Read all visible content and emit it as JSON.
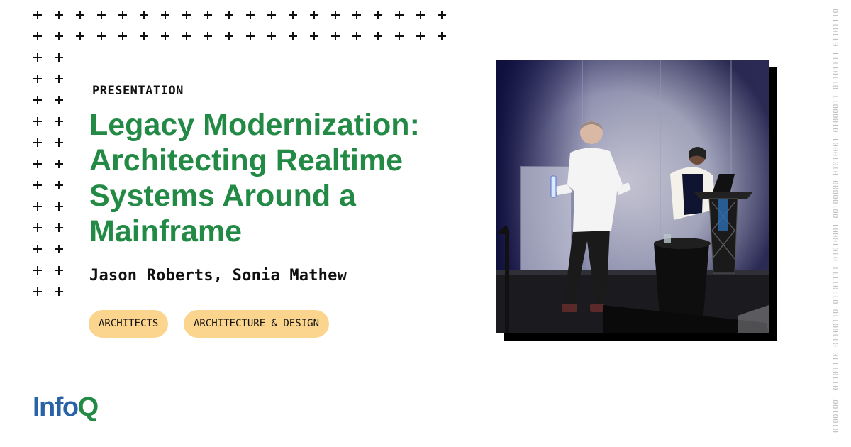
{
  "eyebrow": "PRESENTATION",
  "title": "Legacy Modernization: Architecting Realtime Systems Around a Mainframe",
  "speakers": "Jason Roberts, Sonia Mathew",
  "tags": [
    {
      "label": "ARCHITECTS"
    },
    {
      "label": "ARCHITECTURE & DESIGN"
    }
  ],
  "logo": {
    "part1": "Info",
    "part2": "Q"
  },
  "binary_text": "01001001 01101110 01100110 01101111 01010001 00100000 01010001 01000011 01101111 01101110",
  "colors": {
    "title_green": "#238a45",
    "tag_bg": "#fbd58d",
    "logo_blue": "#2a62a8",
    "logo_green": "#238a45"
  },
  "icons": [
    "plus-pattern"
  ]
}
